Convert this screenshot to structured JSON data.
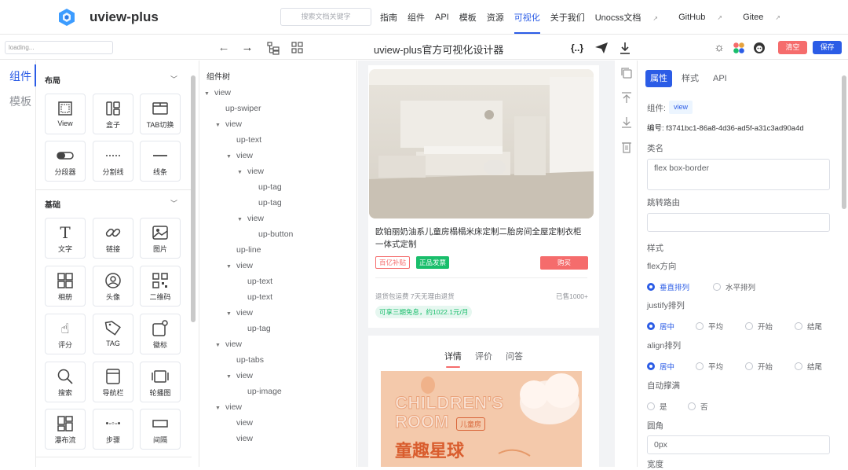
{
  "nav": {
    "brand": "uview-plus",
    "search_placeholder": "搜索文档关键字",
    "links": [
      "指南",
      "组件",
      "API",
      "模板",
      "资源",
      "可视化",
      "关于我们",
      "Unocss文档",
      "GitHub",
      "Gitee"
    ],
    "active_link": "可视化"
  },
  "toolbar": {
    "loading_placeholder": "loading...",
    "title": "uview-plus官方可视化设计器",
    "clear_label": "清空",
    "save_label": "保存"
  },
  "rail": {
    "tabs": [
      "组件",
      "模板"
    ],
    "active": "组件"
  },
  "components": {
    "sections": [
      {
        "title": "布局",
        "items": [
          {
            "label": "View",
            "icon": "view-icon"
          },
          {
            "label": "盒子",
            "icon": "box-icon"
          },
          {
            "label": "TAB切换",
            "icon": "tab-icon"
          },
          {
            "label": "分段器",
            "icon": "segment-icon"
          },
          {
            "label": "分割线",
            "icon": "divider-icon"
          },
          {
            "label": "线条",
            "icon": "line-icon"
          }
        ]
      },
      {
        "title": "基础",
        "items": [
          {
            "label": "文字",
            "icon": "text-icon"
          },
          {
            "label": "链接",
            "icon": "link-icon"
          },
          {
            "label": "图片",
            "icon": "image-icon"
          },
          {
            "label": "相册",
            "icon": "album-icon"
          },
          {
            "label": "头像",
            "icon": "avatar-icon"
          },
          {
            "label": "二维码",
            "icon": "qrcode-icon"
          },
          {
            "label": "评分",
            "icon": "rate-icon"
          },
          {
            "label": "TAG",
            "icon": "tag-icon"
          },
          {
            "label": "徽标",
            "icon": "badge-icon"
          },
          {
            "label": "搜索",
            "icon": "search-icon"
          },
          {
            "label": "导航栏",
            "icon": "navbar-icon"
          },
          {
            "label": "轮播图",
            "icon": "swiper-icon"
          },
          {
            "label": "瀑布流",
            "icon": "waterfall-icon"
          },
          {
            "label": "步骤",
            "icon": "steps-icon"
          },
          {
            "label": "间隔",
            "icon": "gap-icon"
          }
        ]
      }
    ]
  },
  "tree": {
    "title": "组件树",
    "nodes": [
      {
        "label": "view",
        "depth": 0,
        "caret": true
      },
      {
        "label": "up-swiper",
        "depth": 1,
        "caret": false
      },
      {
        "label": "view",
        "depth": 1,
        "caret": true
      },
      {
        "label": "up-text",
        "depth": 2,
        "caret": false
      },
      {
        "label": "view",
        "depth": 2,
        "caret": true
      },
      {
        "label": "view",
        "depth": 3,
        "caret": true
      },
      {
        "label": "up-tag",
        "depth": 4,
        "caret": false
      },
      {
        "label": "up-tag",
        "depth": 4,
        "caret": false
      },
      {
        "label": "view",
        "depth": 3,
        "caret": true
      },
      {
        "label": "up-button",
        "depth": 4,
        "caret": false
      },
      {
        "label": "up-line",
        "depth": 2,
        "caret": false
      },
      {
        "label": "view",
        "depth": 2,
        "caret": true
      },
      {
        "label": "up-text",
        "depth": 3,
        "caret": false
      },
      {
        "label": "up-text",
        "depth": 3,
        "caret": false
      },
      {
        "label": "view",
        "depth": 2,
        "caret": true
      },
      {
        "label": "up-tag",
        "depth": 3,
        "caret": false
      },
      {
        "label": "view",
        "depth": 1,
        "caret": true
      },
      {
        "label": "up-tabs",
        "depth": 2,
        "caret": false
      },
      {
        "label": "view",
        "depth": 2,
        "caret": true
      },
      {
        "label": "up-image",
        "depth": 3,
        "caret": false
      },
      {
        "label": "view",
        "depth": 1,
        "caret": true
      },
      {
        "label": "view",
        "depth": 2,
        "caret": false
      },
      {
        "label": "view",
        "depth": 2,
        "caret": false
      }
    ]
  },
  "preview": {
    "title": "欧铂丽奶油系儿童房榻榻米床定制二胎房间全屋定制衣柜一体式定制",
    "tag_subsidy": "百亿补贴",
    "tag_genuine": "正品发票",
    "buy_label": "购买",
    "shipping": "退货包运费 7天无理由退货",
    "sold": "已售1000+",
    "installment": "可享三期免息，约1022.1元/月",
    "tabs": [
      "详情",
      "评价",
      "问答"
    ],
    "active_tab": "详情",
    "banner_text_1": "CHILDREN'S",
    "banner_text_2": "ROOM",
    "banner_badge": "儿童房",
    "banner_text_3": "童趣星球"
  },
  "props": {
    "tabs": [
      "属性",
      "样式",
      "API"
    ],
    "active_tab": "属性",
    "component_label": "组件:",
    "component_value": "view",
    "id_label": "编号:",
    "id_value": "f3741bc1-86a8-4d36-ad5f-a31c3ad90a4d",
    "class_label": "类名",
    "class_value": "flex box-border",
    "route_label": "跳转路由",
    "route_value": "",
    "style_label": "样式",
    "flex_dir_label": "flex方向",
    "flex_dir_options": [
      "垂直排列",
      "水平排列"
    ],
    "flex_dir_selected": "垂直排列",
    "justify_label": "justify排列",
    "justify_options": [
      "居中",
      "平均",
      "开始",
      "结尾"
    ],
    "justify_selected": "居中",
    "align_label": "align排列",
    "align_options": [
      "居中",
      "平均",
      "开始",
      "结尾"
    ],
    "align_selected": "居中",
    "autofill_label": "自动撑满",
    "autofill_options": [
      "是",
      "否"
    ],
    "radius_label": "圆角",
    "radius_value": "0px",
    "width_label": "宽度"
  },
  "colors": {
    "primary": "#2b5ce6",
    "danger": "#f56c6c",
    "success": "#19be6b"
  }
}
